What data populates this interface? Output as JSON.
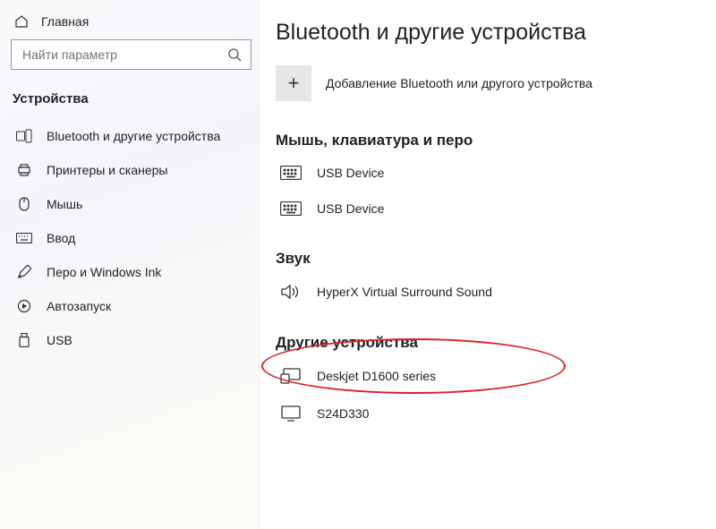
{
  "sidebar": {
    "home": "Главная",
    "search_placeholder": "Найти параметр",
    "section": "Устройства",
    "items": [
      {
        "label": "Bluetooth и другие устройства"
      },
      {
        "label": "Принтеры и сканеры"
      },
      {
        "label": "Мышь"
      },
      {
        "label": "Ввод"
      },
      {
        "label": "Перо и Windows Ink"
      },
      {
        "label": "Автозапуск"
      },
      {
        "label": "USB"
      }
    ]
  },
  "main": {
    "title": "Bluetooth и другие устройства",
    "add_label": "Добавление Bluetooth или другого устройства",
    "groups": [
      {
        "title": "Мышь, клавиатура и перо",
        "devices": [
          {
            "name": "USB Device",
            "icon": "keyboard"
          },
          {
            "name": "USB Device",
            "icon": "keyboard"
          }
        ]
      },
      {
        "title": "Звук",
        "devices": [
          {
            "name": "HyperX Virtual Surround Sound",
            "icon": "speaker"
          }
        ]
      },
      {
        "title": "Другие устройства",
        "devices": [
          {
            "name": "Deskjet D1600 series",
            "icon": "device"
          },
          {
            "name": "S24D330",
            "icon": "monitor"
          }
        ]
      }
    ]
  }
}
